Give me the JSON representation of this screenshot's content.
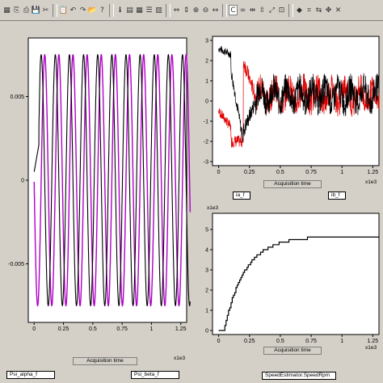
{
  "toolbar": {
    "icons": [
      "grid-icon",
      "copy-icon",
      "print-icon",
      "save-icon",
      "cut-icon",
      "paste-icon",
      "undo-icon",
      "redo-icon",
      "open-icon",
      "help-icon",
      "info-icon",
      "table-icon",
      "grid2-icon",
      "list-icon",
      "chart-icon",
      "x-axis-icon",
      "y-axis-icon",
      "zoom-x-icon",
      "zoom-y-icon",
      "cursor-icon",
      "c-icon",
      "link-icon",
      "scale-x-icon",
      "scale-y-icon",
      "expand-icon",
      "fit-icon",
      "marker-icon",
      "measure-icon",
      "arrows-icon",
      "move-icon",
      "cross-icon"
    ],
    "active_label": "C"
  },
  "colors": {
    "black": "#000000",
    "magenta": "#b000c8",
    "red": "#e00000"
  },
  "panels": {
    "left": {
      "xlabel": "Acquisition time",
      "x_exponent": "x1e3",
      "legend1": "Psi_alpha_f",
      "legend2": "Psi_beta_f",
      "y_ticks": [
        "0.005",
        "0",
        "-0.005"
      ],
      "x_ticks": [
        "0",
        "0.25",
        "0.5",
        "0.75",
        "1",
        "1.25"
      ]
    },
    "top_right": {
      "xlabel": "Acquisition time",
      "x_exponent": "x1e3",
      "legend1": "ia_f",
      "legend2": "ib_f",
      "y_ticks": [
        "3",
        "2",
        "1",
        "0",
        "-1",
        "-2",
        "-3"
      ],
      "x_ticks": [
        "0",
        "0.25",
        "0.5",
        "0.75",
        "1",
        "1.25"
      ]
    },
    "bottom_right": {
      "xlabel": "Acquisition time",
      "y_exponent": "x1e3",
      "x_exponent": "x1e3",
      "legend1": "SpeedEstimator.SpeedRpm",
      "y_ticks": [
        "5",
        "4",
        "3",
        "2",
        "1",
        "0"
      ],
      "x_ticks": [
        "0",
        "0.25",
        "0.5",
        "0.75",
        "1",
        "1.25"
      ]
    }
  },
  "chart_data": [
    {
      "type": "line",
      "xlabel": "Acquisition time",
      "xlim": [
        -0.05,
        1.3
      ],
      "ylim": [
        -0.0085,
        0.0085
      ],
      "series": [
        {
          "name": "Psi_alpha_f",
          "x": [
            0,
            0.02,
            0.05,
            0.08,
            0.11,
            0.14,
            0.17,
            0.2
          ],
          "y": [
            0,
            0.002,
            0.007,
            0.0075,
            -0.0072,
            0.0075,
            -0.0075,
            0.0075
          ]
        },
        {
          "name": "Psi_beta_f",
          "x": [
            0,
            0.02,
            0.05,
            0.08,
            0.11,
            0.14,
            0.17,
            0.2
          ],
          "y": [
            0.0082,
            0.0075,
            -0.007,
            0.0075,
            -0.0074,
            0.0075,
            -0.0075,
            0.0075
          ]
        }
      ]
    },
    {
      "type": "line",
      "xlabel": "Acquisition time",
      "xlim": [
        -0.05,
        1.3
      ],
      "ylim": [
        -3.2,
        3.2
      ],
      "series": [
        {
          "name": "ia_f",
          "x": [
            0,
            0.05,
            0.1,
            0.15,
            0.2,
            0.3,
            0.5,
            1.0,
            1.3
          ],
          "y": [
            2.8,
            2.5,
            1.5,
            -2,
            -0.5,
            0.5,
            0.3,
            0.2,
            0.3
          ]
        },
        {
          "name": "ib_f",
          "x": [
            0,
            0.05,
            0.1,
            0.15,
            0.2,
            0.3,
            0.5,
            1.0,
            1.3
          ],
          "y": [
            0,
            -1,
            -2,
            -2,
            2,
            0.3,
            0.4,
            0.3,
            0.2
          ]
        }
      ]
    },
    {
      "type": "line",
      "xlabel": "Acquisition time",
      "xlim": [
        -0.05,
        1.3
      ],
      "ylim": [
        -0.2,
        5.8
      ],
      "series": [
        {
          "name": "SpeedEstimator.SpeedRpm",
          "x": [
            0,
            0.03,
            0.06,
            0.1,
            0.15,
            0.2,
            0.3,
            0.4,
            0.5,
            0.6,
            0.8,
            1.0,
            1.3
          ],
          "y": [
            0,
            0,
            0.5,
            1.5,
            2.5,
            3.2,
            4.0,
            4.35,
            4.5,
            4.55,
            4.6,
            4.62,
            4.65
          ]
        }
      ]
    }
  ]
}
